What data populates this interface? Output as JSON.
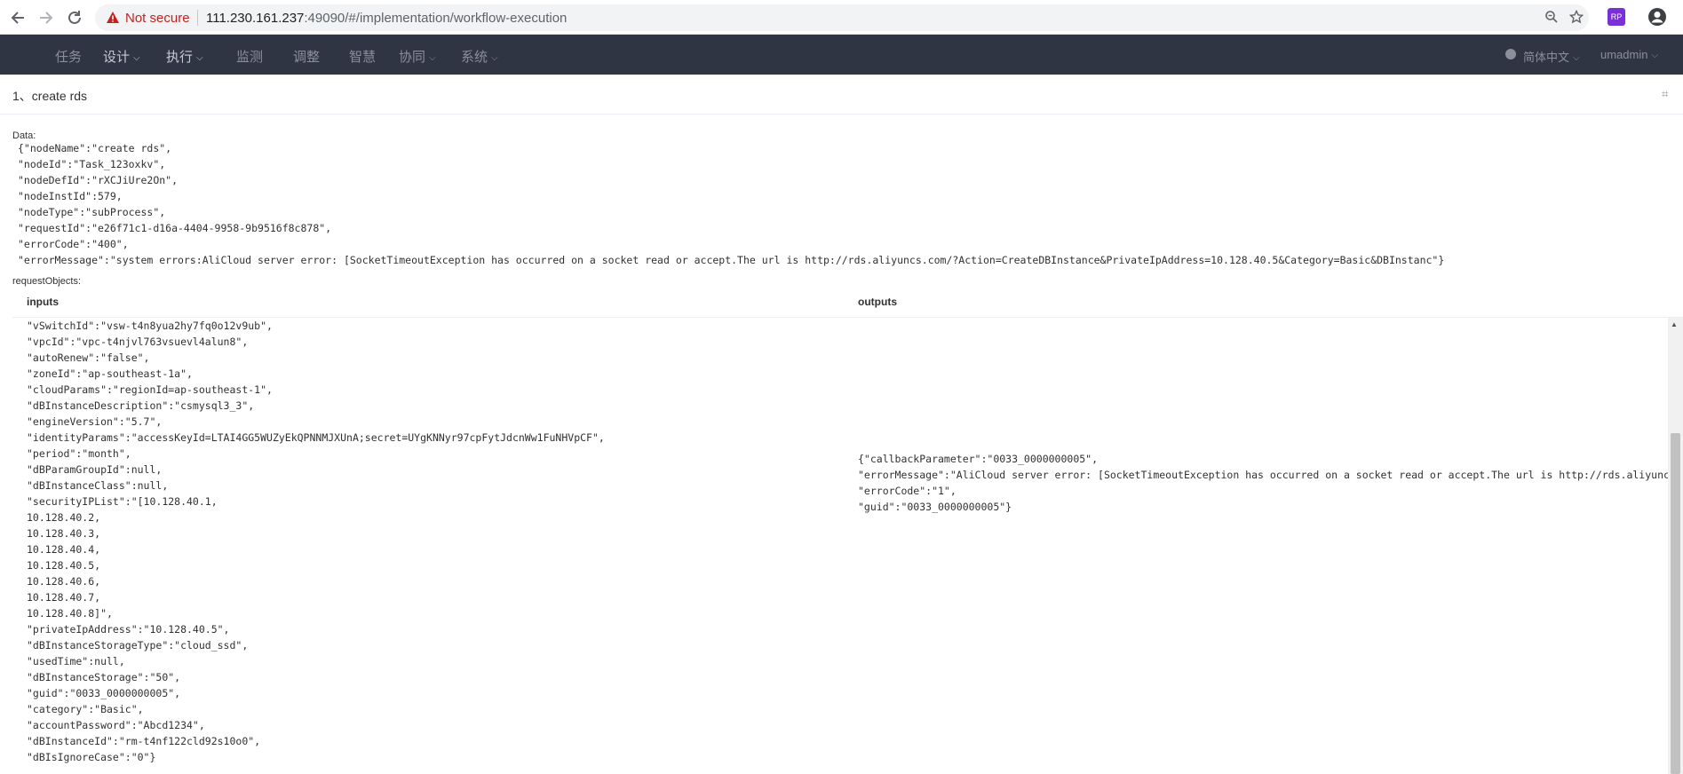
{
  "browser": {
    "not_secure": "Not secure",
    "url_host": "111.230.161.237",
    "url_rest": ":49090/#/implementation/workflow-execution"
  },
  "nav": {
    "items": [
      {
        "label": "任务",
        "has_menu": false
      },
      {
        "label": "设计",
        "has_menu": true
      },
      {
        "label": "执行",
        "has_menu": true
      },
      {
        "label": "监测",
        "has_menu": false
      },
      {
        "label": "调整",
        "has_menu": false
      },
      {
        "label": "智慧",
        "has_menu": false
      },
      {
        "label": "协同",
        "has_menu": true
      },
      {
        "label": "系统",
        "has_menu": true
      }
    ],
    "language": "简体中文",
    "user": "umadmin"
  },
  "page": {
    "title": "1、create rds"
  },
  "data_section": {
    "label": "Data:",
    "lines": [
      "{\"nodeName\":\"create rds\",",
      "\"nodeId\":\"Task_123oxkv\",",
      "\"nodeDefId\":\"rXCJiUre2On\",",
      "\"nodeInstId\":579,",
      "\"nodeType\":\"subProcess\",",
      "\"requestId\":\"e26f71c1-d16a-4404-9958-9b9516f8c878\",",
      "\"errorCode\":\"400\",",
      "\"errorMessage\":\"system errors:AliCloud server error: [SocketTimeoutException has occurred on a socket read or accept.The url is http://rds.aliyuncs.com/?Action=CreateDBInstance&PrivateIpAddress=10.128.40.5&Category=Basic&DBInstanc\"}"
    ]
  },
  "request_section": {
    "label": "requestObjects:",
    "inputs_header": "inputs",
    "outputs_header": "outputs",
    "inputs_lines": [
      "\"vSwitchId\":\"vsw-t4n8yua2hy7fq0o12v9ub\",",
      "\"vpcId\":\"vpc-t4njvl763vsuevl4alun8\",",
      "\"autoRenew\":\"false\",",
      "\"zoneId\":\"ap-southeast-1a\",",
      "\"cloudParams\":\"regionId=ap-southeast-1\",",
      "\"dBInstanceDescription\":\"csmysql3_3\",",
      "\"engineVersion\":\"5.7\",",
      "\"identityParams\":\"accessKeyId=LTAI4GG5WUZyEkQPNNMJXUnA;secret=UYgKNNyr97cpFytJdcnWw1FuNHVpCF\",",
      "\"period\":\"month\",",
      "\"dBParamGroupId\":null,",
      "\"dBInstanceClass\":null,",
      "\"securityIPList\":\"[10.128.40.1,",
      "10.128.40.2,",
      "10.128.40.3,",
      "10.128.40.4,",
      "10.128.40.5,",
      "10.128.40.6,",
      "10.128.40.7,",
      "10.128.40.8]\",",
      "\"privateIpAddress\":\"10.128.40.5\",",
      "\"dBInstanceStorageType\":\"cloud_ssd\",",
      "\"usedTime\":null,",
      "\"dBInstanceStorage\":\"50\",",
      "\"guid\":\"0033_0000000005\",",
      "\"category\":\"Basic\",",
      "\"accountPassword\":\"Abcd1234\",",
      "\"dBInstanceId\":\"rm-t4nf122cld92s10o0\",",
      "\"dBIsIgnoreCase\":\"0\"}"
    ],
    "outputs_lines": [
      "{\"callbackParameter\":\"0033_0000000005\",",
      "\"errorMessage\":\"AliCloud server error: [SocketTimeoutException has occurred on a socket read or accept.The url is http://rds.aliyuncs",
      "\"errorCode\":\"1\",",
      "\"guid\":\"0033_0000000005\"}"
    ]
  }
}
